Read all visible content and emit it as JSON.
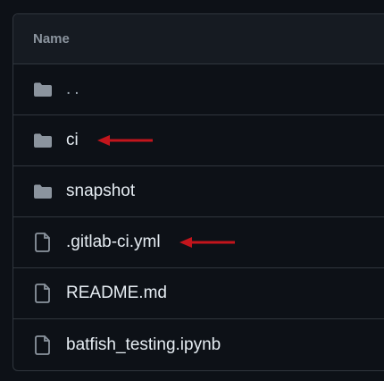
{
  "table": {
    "header": "Name",
    "rows": [
      {
        "name": "..",
        "icon": "folder-icon",
        "highlighted": false
      },
      {
        "name": "ci",
        "icon": "folder-icon",
        "highlighted": true
      },
      {
        "name": "snapshot",
        "icon": "folder-icon",
        "highlighted": false
      },
      {
        "name": ".gitlab-ci.yml",
        "icon": "file-icon",
        "highlighted": true
      },
      {
        "name": "README.md",
        "icon": "file-icon",
        "highlighted": false
      },
      {
        "name": "batfish_testing.ipynb",
        "icon": "file-icon",
        "highlighted": false
      }
    ]
  },
  "colors": {
    "background": "#0d1117",
    "header_background": "#161b22",
    "border": "#30363d",
    "text": "#e6edf3",
    "icon": "#8b949e",
    "annotation_arrow": "#c3151c"
  }
}
